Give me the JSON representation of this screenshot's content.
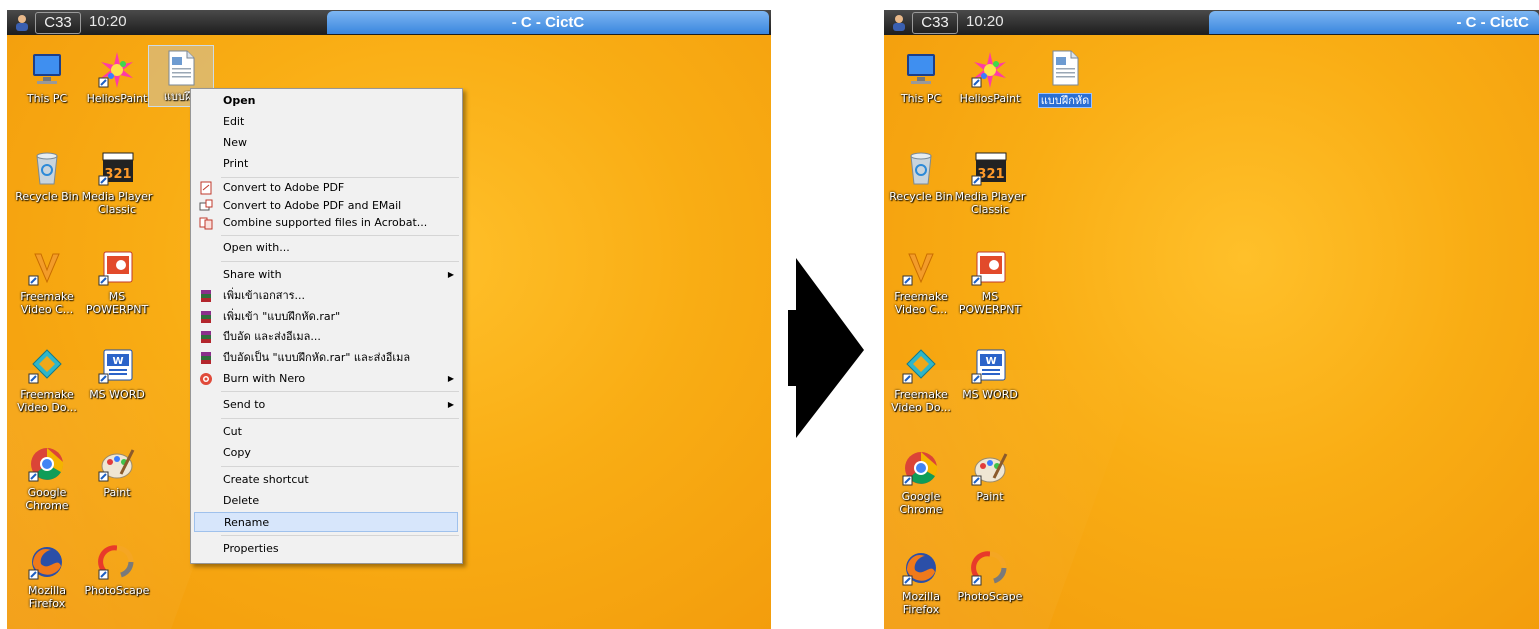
{
  "screens": {
    "left": {
      "session": "C33",
      "time": "10:20",
      "title": "- C - CictC"
    },
    "right": {
      "session": "C33",
      "time": "10:20",
      "title": "- C - CictC"
    }
  },
  "desktop_icons": {
    "this_pc": "This PC",
    "heliospaint": "HeliosPaint",
    "file_left": "แบบฝึก",
    "file_right": "แบบฝึกหัด",
    "recycle_bin": "Recycle Bin",
    "media_player": [
      "Media Player",
      "Classic"
    ],
    "freemake_video_c": [
      "Freemake",
      "Video C..."
    ],
    "ms_powerpnt": [
      "MS",
      "POWERPNT"
    ],
    "freemake_video_do": [
      "Freemake",
      "Video Do..."
    ],
    "ms_word": "MS WORD",
    "google_chrome": [
      "Google",
      "Chrome"
    ],
    "paint": "Paint",
    "mozilla_firefox": [
      "Mozilla",
      "Firefox"
    ],
    "photoscape": "PhotoScape"
  },
  "context_menu": {
    "open": "Open",
    "edit": "Edit",
    "new": "New",
    "print": "Print",
    "convert_pdf": "Convert to Adobe PDF",
    "convert_pdf_email": "Convert to Adobe PDF and EMail",
    "combine_acrobat": "Combine supported files in Acrobat...",
    "open_with": "Open with...",
    "share_with": "Share with",
    "add_to_archive": "เพิ่มเข้าเอกสาร...",
    "add_to_rar": "เพิ่มเข้า \"แบบฝึกหัด.rar\"",
    "compress_email": "บีบอัด และส่งอีเมล...",
    "compress_rar_email": "บีบอัดเป็น \"แบบฝึกหัด.rar\" และส่งอีเมล",
    "burn_nero": "Burn with Nero",
    "send_to": "Send to",
    "cut": "Cut",
    "copy": "Copy",
    "create_shortcut": "Create shortcut",
    "delete": "Delete",
    "rename": "Rename",
    "properties": "Properties"
  },
  "colors": {
    "desktop": "#f9ad14",
    "menu_bg": "#f1f1f1",
    "highlight": "#d7e6fb",
    "title_bar": "#3a86de"
  }
}
